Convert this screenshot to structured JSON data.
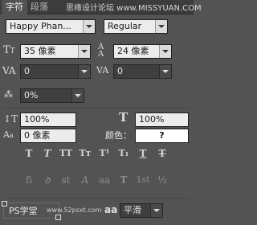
{
  "tabs": [
    {
      "label": "字符"
    },
    {
      "label": "段落"
    }
  ],
  "watermark": "思缘设计论坛 www.MISSYUAN.COM",
  "font": {
    "family": "Happy Phan...",
    "style": "Regular"
  },
  "size": {
    "font_size": "35 像素",
    "leading": "24 像素"
  },
  "spacing": {
    "kerning": "0",
    "tracking": "0",
    "tsume": "0%"
  },
  "scale": {
    "vertical": "100%",
    "horizontal": "100%"
  },
  "baseline_shift": "0 像素",
  "color": {
    "label": "颜色：",
    "value": "?",
    "swatch": "#ffffff"
  },
  "format_buttons": [
    {
      "label": "T",
      "icon": "faux-bold-icon"
    },
    {
      "label": "T",
      "icon": "faux-italic-icon"
    },
    {
      "label": "TT",
      "icon": "all-caps-icon"
    },
    {
      "label": "Tт",
      "icon": "small-caps-icon"
    },
    {
      "label": "T¹",
      "icon": "superscript-icon"
    },
    {
      "label": "T₁",
      "icon": "subscript-icon"
    },
    {
      "label": "T",
      "icon": "underline-icon"
    },
    {
      "label": "T",
      "icon": "strikethrough-icon"
    }
  ],
  "opentype_buttons": [
    {
      "label": "fi",
      "icon": "ligatures-icon"
    },
    {
      "label": "ꝺ",
      "icon": "discretionary-ligatures-icon"
    },
    {
      "label": "st",
      "icon": "contextual-alternates-icon"
    },
    {
      "label": "A",
      "icon": "swash-icon"
    },
    {
      "label": "aa",
      "icon": "stylistic-alternates-icon"
    },
    {
      "label": "T",
      "icon": "titling-alternates-icon"
    },
    {
      "label": "1st",
      "icon": "ordinals-icon"
    },
    {
      "label": "½",
      "icon": "fractions-icon"
    }
  ],
  "language": "PS学堂",
  "watermark2": "www.52psxt.com",
  "antialias": {
    "icon": "aa",
    "value": "平滑"
  }
}
